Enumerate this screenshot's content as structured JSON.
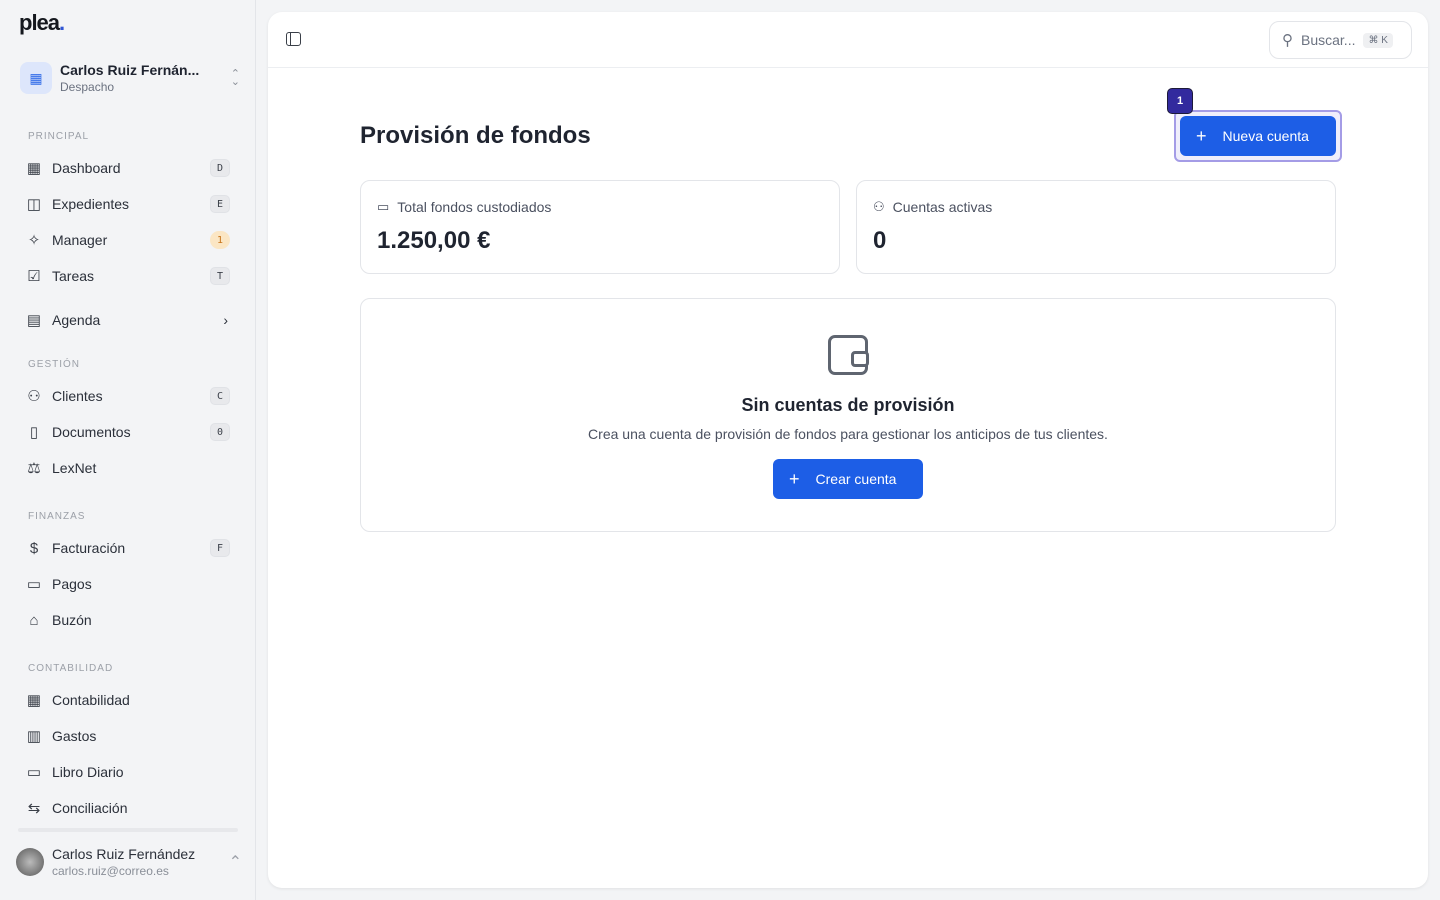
{
  "app": {
    "logo": "plea",
    "logo_dot": "."
  },
  "org": {
    "name": "Carlos Ruiz Fernán...",
    "type": "Despacho"
  },
  "sidebar": {
    "sections": [
      {
        "title": "PRINCIPAL",
        "items": [
          {
            "label": "Dashboard",
            "key": "D"
          },
          {
            "label": "Expedientes",
            "key": "E"
          },
          {
            "label": "Manager",
            "key": "1"
          },
          {
            "label": "Tareas",
            "key": "T"
          },
          {
            "label": "Agenda"
          }
        ]
      },
      {
        "title": "GESTIÓN",
        "items": [
          {
            "label": "Clientes",
            "key": "C"
          },
          {
            "label": "Documentos",
            "key": "0"
          },
          {
            "label": "LexNet"
          }
        ]
      },
      {
        "title": "FINANZAS",
        "items": [
          {
            "label": "Facturación",
            "key": "F"
          },
          {
            "label": "Pagos"
          },
          {
            "label": "Buzón"
          }
        ]
      },
      {
        "title": "CONTABILIDAD",
        "items": [
          {
            "label": "Contabilidad"
          },
          {
            "label": "Gastos"
          },
          {
            "label": "Libro Diario"
          },
          {
            "label": "Conciliación"
          }
        ]
      }
    ]
  },
  "user": {
    "name": "Carlos Ruiz Fernández",
    "email": "carlos.ruiz@correo.es"
  },
  "topbar": {
    "search_placeholder": "Buscar...",
    "search_shortcut": "⌘ K"
  },
  "page": {
    "title": "Provisión de fondos",
    "new_button": "Nueva cuenta",
    "badge": "1"
  },
  "stats": [
    {
      "label": "Total fondos custodiados",
      "value": "1.250,00 €"
    },
    {
      "label": "Cuentas activas",
      "value": "0"
    }
  ],
  "empty": {
    "title": "Sin cuentas de provisión",
    "description": "Crea una cuenta de provisión de fondos para gestionar los anticipos de tus clientes.",
    "button": "Crear cuenta"
  }
}
